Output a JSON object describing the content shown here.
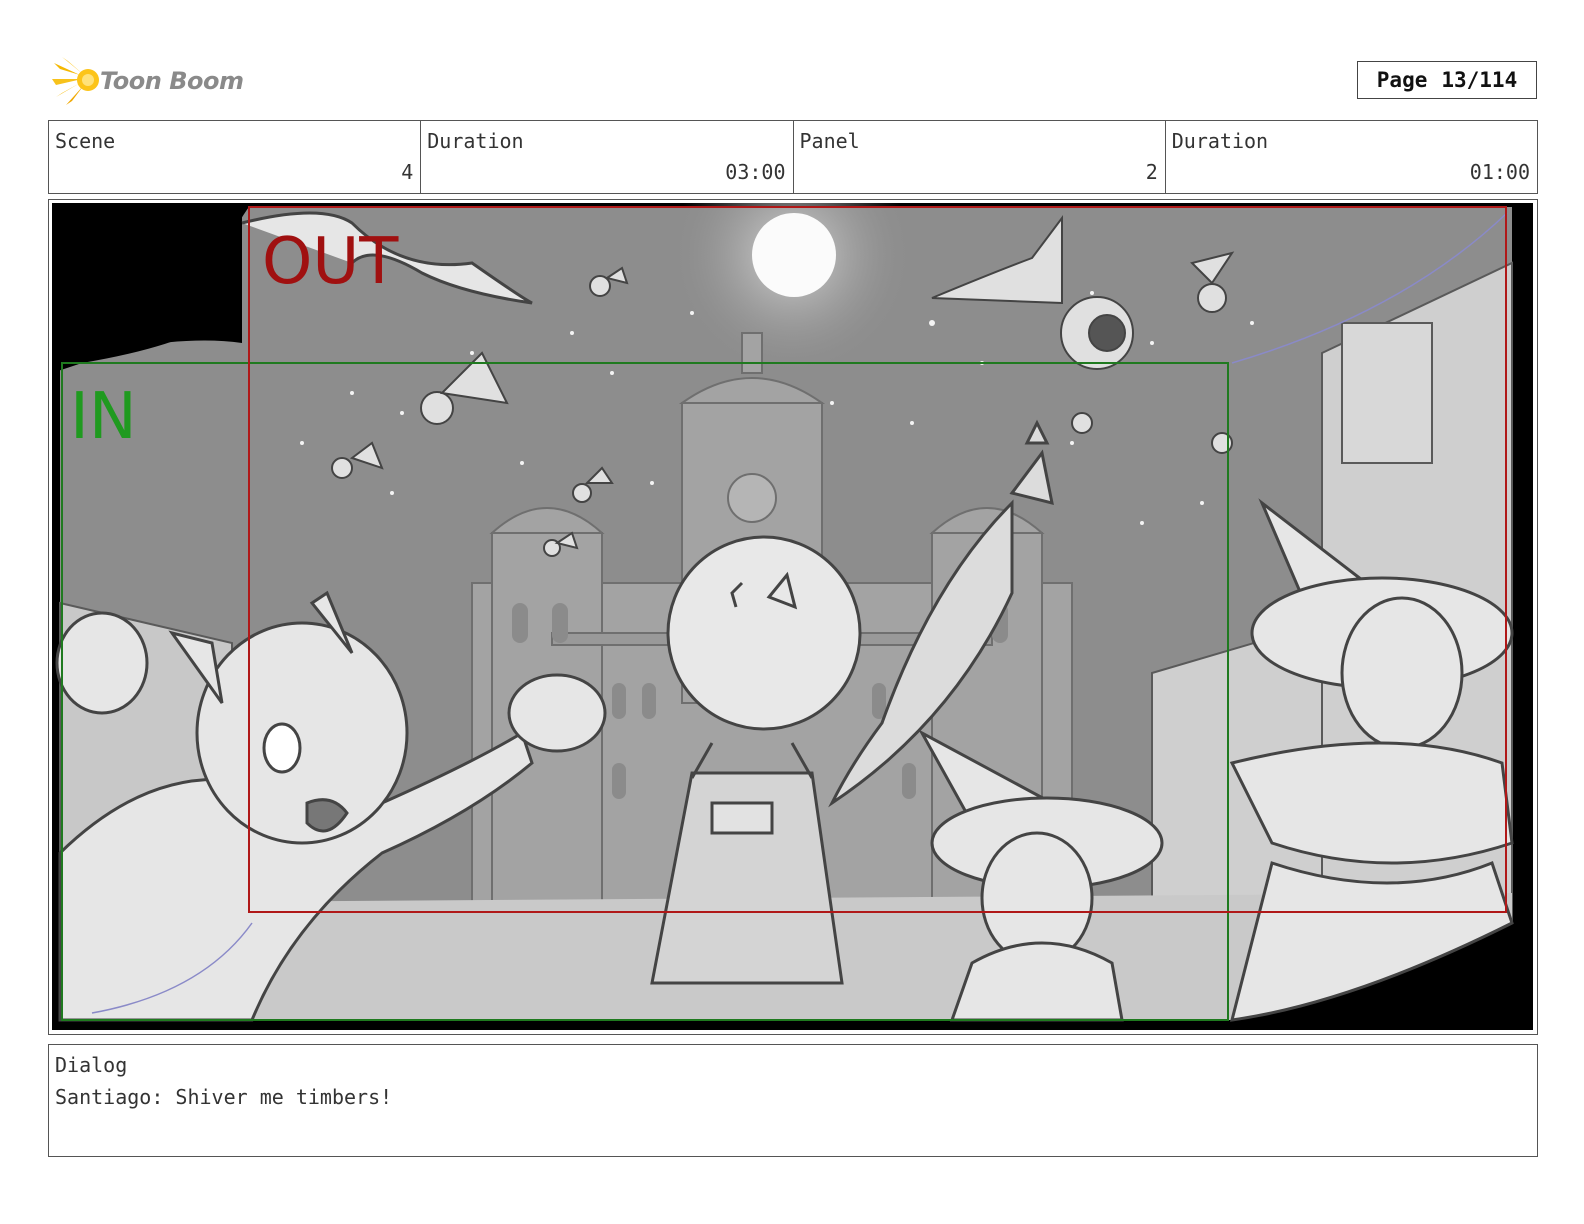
{
  "header": {
    "logo_text": "Toon Boom",
    "page_label": "Page",
    "page_value": "13/114"
  },
  "info": {
    "scene_label": "Scene",
    "scene_value": "4",
    "scene_duration_label": "Duration",
    "scene_duration_value": "03:00",
    "panel_label": "Panel",
    "panel_value": "2",
    "panel_duration_label": "Duration",
    "panel_duration_value": "01:00"
  },
  "panel": {
    "out_label": "OUT",
    "in_label": "IN",
    "out_color": "#a01010",
    "in_color": "#1f9a1f",
    "sky_color": "#8d8d8d"
  },
  "dialog": {
    "label": "Dialog",
    "text": "Santiago: Shiver me timbers!"
  },
  "icons": [
    "toon-boom-logo-icon"
  ]
}
